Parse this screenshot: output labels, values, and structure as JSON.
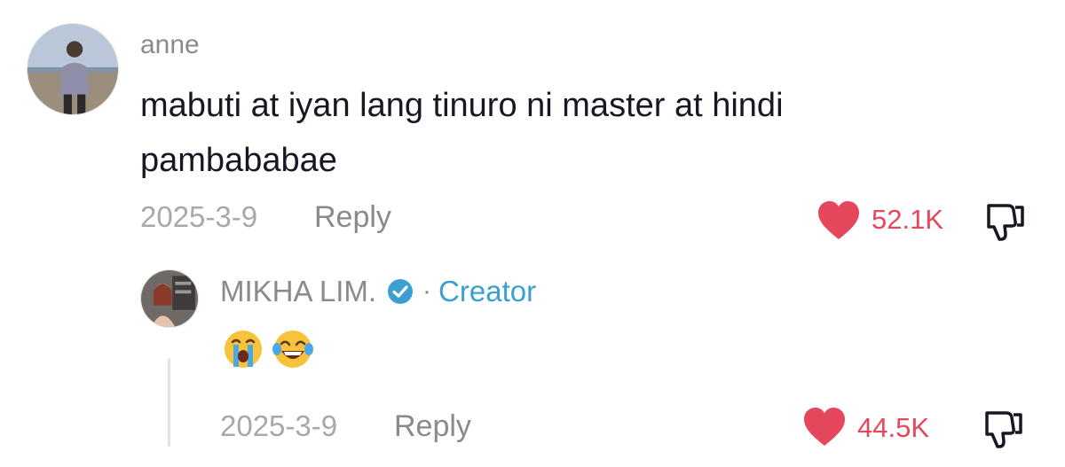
{
  "comment": {
    "username": "anne",
    "text": "mabuti at iyan lang tinuro ni master at hindi pambababae",
    "date": "2025-3-9",
    "reply_label": "Reply",
    "likes": "52.1K",
    "avatar_icon": "user-avatar-beach"
  },
  "reply": {
    "username": "MIKHA LIM.",
    "separator": "·",
    "role": "Creator",
    "emojis": [
      "loudly-crying-face-icon",
      "tears-of-joy-face-icon"
    ],
    "date": "2025-3-9",
    "reply_label": "Reply",
    "likes": "44.5K",
    "avatar_icon": "creator-avatar"
  },
  "colors": {
    "like_red": "#e5485c",
    "creator_blue": "#3b9fcf",
    "verified_blue": "#3b9fcf",
    "muted_gray": "#8a8a8a"
  }
}
